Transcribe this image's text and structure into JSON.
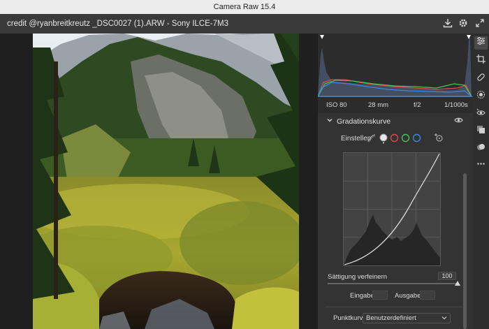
{
  "app": {
    "title": "Camera Raw 15.4"
  },
  "header": {
    "file_label": "credit @ryanbreitkreutz _DSC0027 (1).ARW - Sony ILCE-7M3"
  },
  "camera_info": {
    "iso": "ISO 80",
    "focal_length": "28 mm",
    "aperture": "f/2",
    "shutter": "1/1000s"
  },
  "curve_panel": {
    "title": "Gradationskurve",
    "einstellen_label": "Einstellen",
    "slider_label": "Sättigung verfeinern",
    "slider_value": "100",
    "slider_fraction": 1.0,
    "input_label": "Eingabe:",
    "output_label": "Ausgabe:",
    "punktkurve_label": "Punktkurve",
    "punktkurve_value": "Benutzerdefiniert"
  },
  "channel_colors": {
    "red": "#e0484b",
    "green": "#4bbf58",
    "blue": "#3d86e0"
  },
  "toolstrip": [
    "edit-sliders-icon",
    "crop-icon",
    "healing-brush-icon",
    "masking-icon",
    "red-eye-icon",
    "presets-icon",
    "snapshots-icon",
    "more-icon"
  ]
}
